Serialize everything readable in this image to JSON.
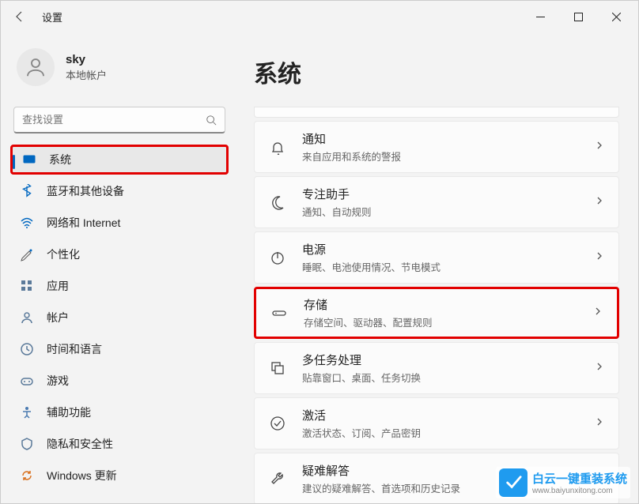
{
  "window": {
    "title": "设置"
  },
  "account": {
    "name": "sky",
    "type": "本地帐户"
  },
  "search": {
    "placeholder": "查找设置"
  },
  "sidebar": {
    "items": [
      {
        "label": "系统",
        "icon": "system",
        "active": true,
        "highlighted": true
      },
      {
        "label": "蓝牙和其他设备",
        "icon": "bluetooth"
      },
      {
        "label": "网络和 Internet",
        "icon": "network"
      },
      {
        "label": "个性化",
        "icon": "personalize"
      },
      {
        "label": "应用",
        "icon": "apps"
      },
      {
        "label": "帐户",
        "icon": "accounts"
      },
      {
        "label": "时间和语言",
        "icon": "time"
      },
      {
        "label": "游戏",
        "icon": "gaming"
      },
      {
        "label": "辅助功能",
        "icon": "accessibility"
      },
      {
        "label": "隐私和安全性",
        "icon": "privacy"
      },
      {
        "label": "Windows 更新",
        "icon": "update"
      }
    ]
  },
  "main": {
    "title": "系统",
    "cards": [
      {
        "title": "通知",
        "sub": "来自应用和系统的警报",
        "icon": "bell"
      },
      {
        "title": "专注助手",
        "sub": "通知、自动规则",
        "icon": "moon"
      },
      {
        "title": "电源",
        "sub": "睡眠、电池使用情况、节电模式",
        "icon": "power"
      },
      {
        "title": "存储",
        "sub": "存储空间、驱动器、配置规则",
        "icon": "storage",
        "highlighted": true
      },
      {
        "title": "多任务处理",
        "sub": "贴靠窗口、桌面、任务切换",
        "icon": "multitask"
      },
      {
        "title": "激活",
        "sub": "激活状态、订阅、产品密钥",
        "icon": "check"
      },
      {
        "title": "疑难解答",
        "sub": "建议的疑难解答、首选项和历史记录",
        "icon": "wrench"
      }
    ]
  },
  "watermark": {
    "big": "白云一键重装系统",
    "small": "www.baiyunxitong.com"
  },
  "colors": {
    "accent": "#0067c0",
    "highlight": "#e20000",
    "wm": "#1f9bef"
  }
}
